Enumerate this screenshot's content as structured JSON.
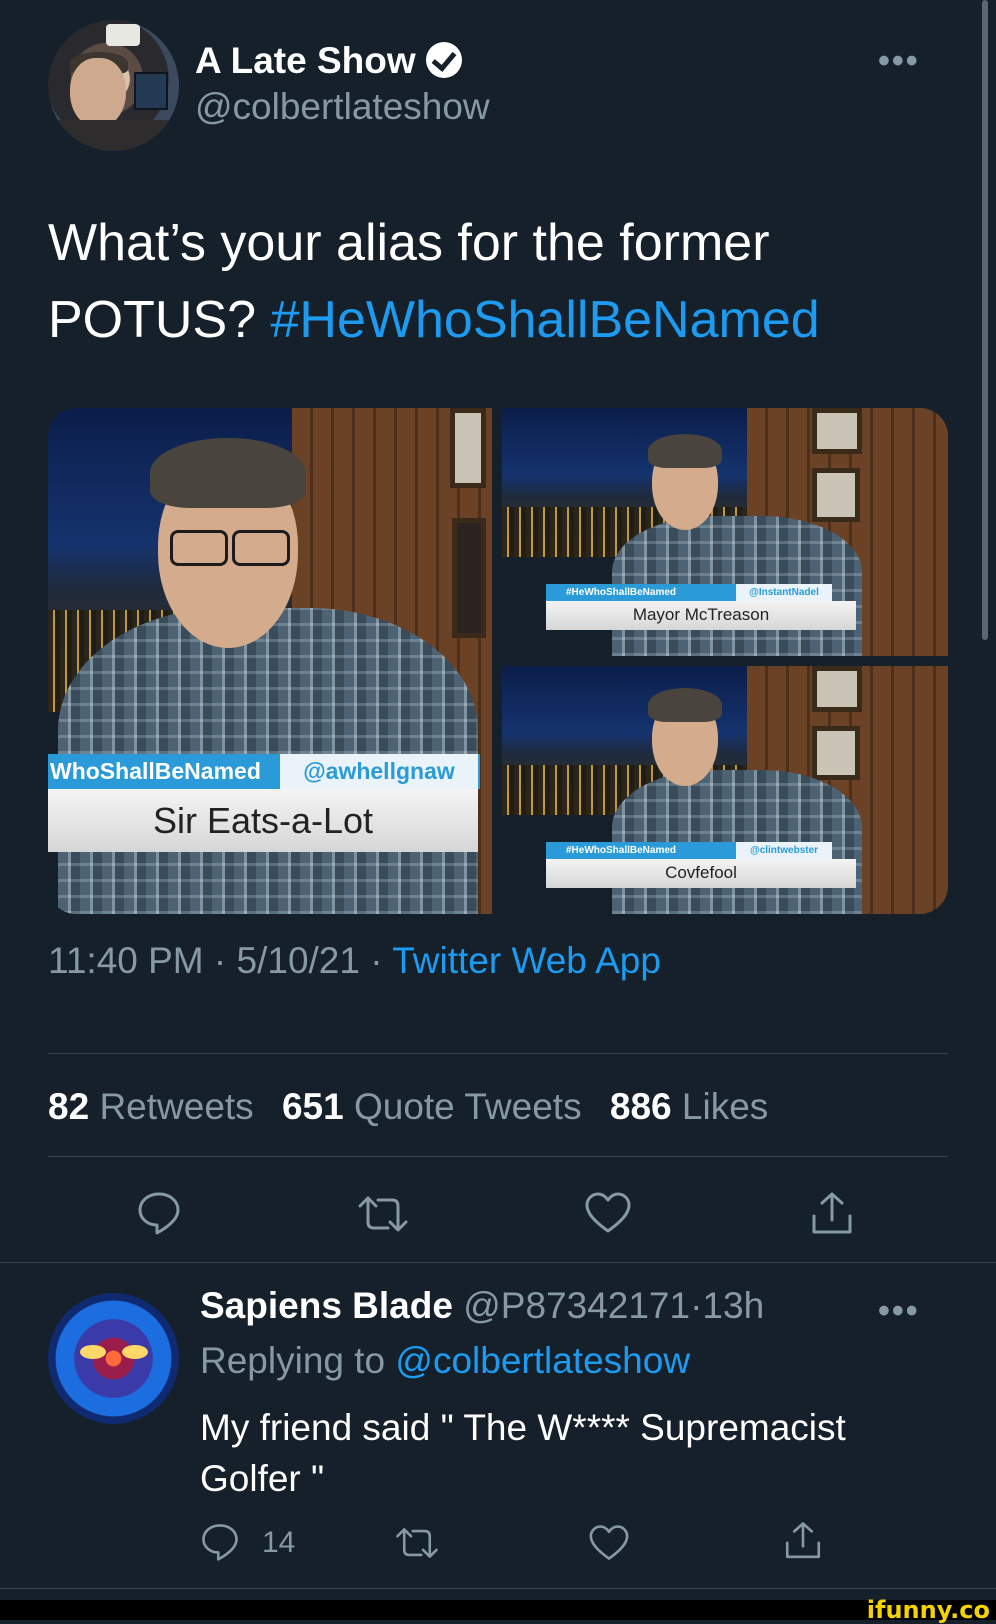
{
  "tweet": {
    "author_name": "A Late Show",
    "author_handle": "@colbertlateshow",
    "text_plain": "What’s your alias for the former POTUS? ",
    "hashtag": "#HeWhoShallBeNamed",
    "more_label": "•••",
    "media": [
      {
        "tag": "WhoShallBeNamed",
        "credit": "@awhellgnaw",
        "caption": "Sir Eats-a-Lot"
      },
      {
        "tag": "#HeWhoShallBeNamed",
        "credit": "@InstantNadel",
        "caption": "Mayor McTreason"
      },
      {
        "tag": "#HeWhoShallBeNamed",
        "credit": "@clintwebster",
        "caption": "Covfefool"
      }
    ],
    "time": "11:40 PM",
    "date": "5/10/21",
    "separator": "·",
    "app": "Twitter Web App",
    "stats": {
      "retweets_count": "82",
      "retweets_label": "Retweets",
      "quotes_count": "651",
      "quotes_label": "Quote Tweets",
      "likes_count": "886",
      "likes_label": "Likes"
    },
    "actions": [
      "reply-icon",
      "retweet-icon",
      "like-icon",
      "share-icon"
    ]
  },
  "reply": {
    "author_name": "Sapiens Blade",
    "author_handle": "@P87342171",
    "separator": "·",
    "age": "13h",
    "replying_prefix": "Replying to",
    "replying_to": "@colbertlateshow",
    "text": "My friend said \" The W**** Supremacist Golfer \"",
    "more_label": "•••",
    "reply_count": "14"
  },
  "watermark": "ifunny.co",
  "colors": {
    "background": "#15202b",
    "link": "#1d9bf0",
    "muted": "#8899a6",
    "divider": "#38444d"
  }
}
